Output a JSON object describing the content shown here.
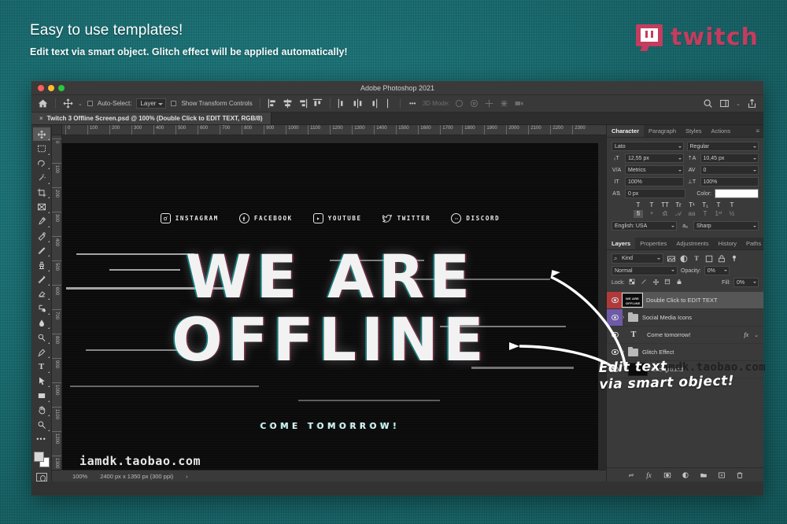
{
  "header": {
    "title": "Easy to use templates!",
    "subtitle": "Edit text via smart object. Glitch effect will be applied automatically!",
    "brand": "twitch",
    "brand_color": "#c43c5e"
  },
  "window": {
    "title": "Adobe Photoshop 2021",
    "document_tab": "Twitch 3 Offline Screen.psd @ 100% (Double Click to EDIT TEXT, RGB/8)",
    "tab_close": "×"
  },
  "options_bar": {
    "home_icon": "home-icon",
    "move_tool_icon": "move-tool-icon",
    "auto_select_label": "Auto-Select:",
    "auto_select_value": "Layer",
    "show_transform_label": "Show Transform Controls",
    "mode_3d_label": "3D Mode:",
    "search_icon": "search-icon",
    "workspace_icon": "workspace-icon",
    "share_icon": "share-icon"
  },
  "tools": [
    {
      "name": "move-tool",
      "glyph": "move"
    },
    {
      "name": "marquee-tool",
      "glyph": "marquee"
    },
    {
      "name": "lasso-tool",
      "glyph": "lasso"
    },
    {
      "name": "quick-selection-tool",
      "glyph": "wand"
    },
    {
      "name": "crop-tool",
      "glyph": "crop"
    },
    {
      "name": "frame-tool",
      "glyph": "frame"
    },
    {
      "name": "eyedropper-tool",
      "glyph": "eyedropper"
    },
    {
      "name": "healing-brush-tool",
      "glyph": "healing"
    },
    {
      "name": "brush-tool",
      "glyph": "brush"
    },
    {
      "name": "clone-stamp-tool",
      "glyph": "stamp"
    },
    {
      "name": "history-brush-tool",
      "glyph": "historybrush"
    },
    {
      "name": "eraser-tool",
      "glyph": "eraser"
    },
    {
      "name": "gradient-tool",
      "glyph": "paintbucket"
    },
    {
      "name": "blur-tool",
      "glyph": "blur"
    },
    {
      "name": "dodge-tool",
      "glyph": "dodge"
    },
    {
      "name": "pen-tool",
      "glyph": "pen"
    },
    {
      "name": "type-tool",
      "glyph": "type"
    },
    {
      "name": "path-selection-tool",
      "glyph": "pathselect"
    },
    {
      "name": "shape-tool",
      "glyph": "rect"
    },
    {
      "name": "hand-tool",
      "glyph": "hand"
    },
    {
      "name": "zoom-tool",
      "glyph": "zoom"
    },
    {
      "name": "more-tools",
      "glyph": "ellipsis"
    }
  ],
  "rulers": {
    "h_ticks": [
      "0",
      "100",
      "200",
      "300",
      "400",
      "500",
      "600",
      "700",
      "800",
      "900",
      "1000",
      "1100",
      "1200",
      "1300",
      "1400",
      "1500",
      "1600",
      "1700",
      "1800",
      "1900",
      "2000",
      "2100",
      "2200",
      "2300"
    ],
    "v_ticks": [
      "0",
      "100",
      "200",
      "300",
      "400",
      "500",
      "600",
      "700",
      "800",
      "900",
      "1000",
      "1100",
      "1200",
      "1300"
    ]
  },
  "artwork": {
    "social_icons": [
      {
        "name": "instagram",
        "label": "INSTAGRAM"
      },
      {
        "name": "facebook",
        "label": "FACEBOOK"
      },
      {
        "name": "youtube",
        "label": "YOUTUBE"
      },
      {
        "name": "twitter",
        "label": "TWITTER"
      },
      {
        "name": "discord",
        "label": "DISCORD"
      }
    ],
    "headline_line1": "WE ARE",
    "headline_line2": "OFFLINE",
    "subline": "COME TOMORROW!",
    "watermark": "iamdk.taobao.com"
  },
  "status_bar": {
    "zoom": "100%",
    "dimensions": "2400 px x 1350 px (300 ppi)",
    "arrow": "›"
  },
  "character_panel": {
    "tabs": [
      "Character",
      "Paragraph",
      "Styles",
      "Actions"
    ],
    "active_tab": "Character",
    "font_family": "Lato",
    "font_style": "Regular",
    "font_size": "12,55 px",
    "leading": "10,45 px",
    "kerning": "Metrics",
    "tracking": "0",
    "vertical_scale": "100%",
    "horizontal_scale": "100%",
    "baseline_shift": "0 px",
    "color_label": "Color:",
    "color_value": "#ffffff",
    "style_buttons": [
      "T",
      "T",
      "TT",
      "Tr",
      "T¹",
      "T₁",
      "T",
      "T"
    ],
    "ot_buttons": [
      "fi",
      "ᵃ",
      "ﬆ",
      "𝒜",
      "aa",
      "T",
      "1ˢᵗ",
      "½"
    ],
    "language": "English: USA",
    "anti_alias": "Sharp"
  },
  "layers_panel": {
    "tabs": [
      "Layers",
      "Properties",
      "Adjustments",
      "History",
      "Paths"
    ],
    "active_tab": "Layers",
    "kind_filter": "Kind",
    "filter_icons": [
      "pixel-filter-icon",
      "adjustment-filter-icon",
      "type-filter-icon",
      "shape-filter-icon",
      "smartobject-filter-icon",
      "filter-toggle-icon"
    ],
    "blend_mode": "Normal",
    "opacity_label": "Opacity:",
    "opacity_value": "0%",
    "lock_label": "Lock:",
    "fill_label": "Fill:",
    "fill_value": "0%",
    "lock_icons": [
      "lock-transparent-icon",
      "lock-image-icon",
      "lock-position-icon",
      "lock-artboard-icon",
      "lock-all-icon"
    ],
    "layers": [
      {
        "name": "Double Click to EDIT TEXT",
        "type": "smartobject",
        "selected": true,
        "eye_color": "#b03a3a",
        "has_fx": false,
        "expandable": false
      },
      {
        "name": "Social Media Icons",
        "type": "group",
        "selected": false,
        "eye_color": "#6e5aa8",
        "has_fx": false,
        "expandable": true
      },
      {
        "name": "Come tomorrow!",
        "type": "text",
        "selected": false,
        "eye_color": "",
        "has_fx": true,
        "expandable": false
      },
      {
        "name": "Glitch Effect",
        "type": "group",
        "selected": false,
        "eye_color": "",
        "has_fx": false,
        "expandable": true
      },
      {
        "name": "Background",
        "type": "image",
        "selected": false,
        "eye_color": "",
        "has_fx": false,
        "expandable": false
      }
    ],
    "footer_icons": [
      "link-layers-icon",
      "layer-style-icon",
      "layer-mask-icon",
      "adjustment-layer-icon",
      "new-group-icon",
      "new-layer-icon",
      "delete-layer-icon"
    ],
    "fx_label": "fx",
    "watermark": "iamdk.taobao.com"
  },
  "annotation": {
    "line1": "Edit text",
    "line2": "via smart object!"
  }
}
